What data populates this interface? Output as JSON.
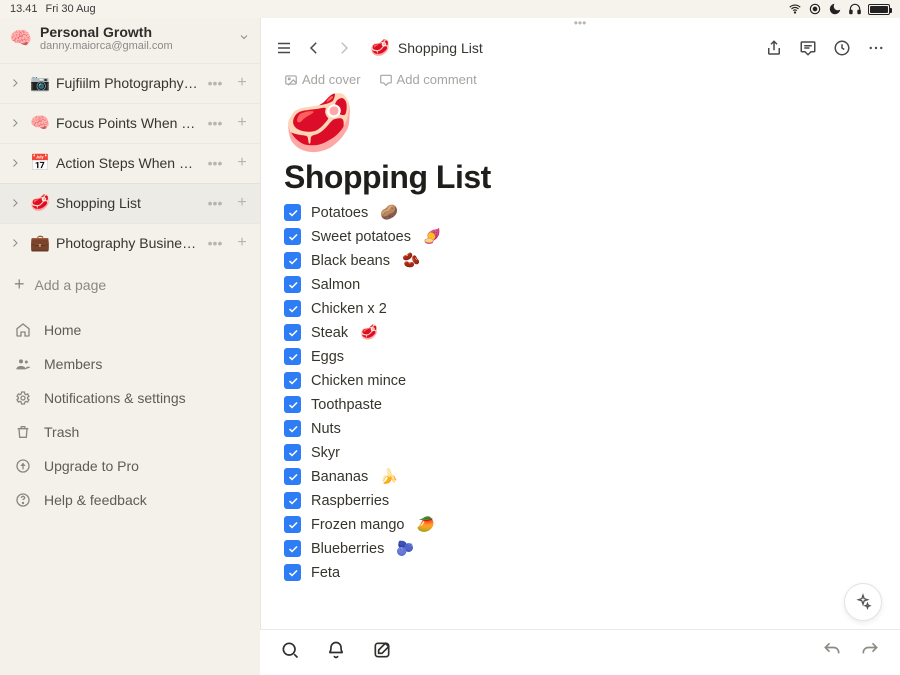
{
  "status": {
    "time": "13.41",
    "date": "Fri 30 Aug"
  },
  "workspace": {
    "name": "Personal Growth",
    "email": "danny.maiorca@gmail.com",
    "icon": "🧠"
  },
  "sidebar": {
    "pages": [
      {
        "icon": "📷",
        "title": "Fujfiilm Photography ..."
      },
      {
        "icon": "🧠",
        "title": "Focus Points When I'..."
      },
      {
        "icon": "📅",
        "title": "Action Steps When B..."
      },
      {
        "icon": "🥩",
        "title": "Shopping List"
      },
      {
        "icon": "💼",
        "title": "Photography Busines..."
      }
    ],
    "active_index": 3,
    "add_page": "Add a page",
    "nav": {
      "home": "Home",
      "members": "Members",
      "settings": "Notifications & settings",
      "trash": "Trash",
      "upgrade": "Upgrade to Pro",
      "help": "Help & feedback"
    }
  },
  "page": {
    "breadcrumb_icon": "🥩",
    "breadcrumb": "Shopping List",
    "add_cover": "Add cover",
    "add_comment": "Add comment",
    "hero_icon": "🥩",
    "title": "Shopping List",
    "items": [
      {
        "text": "Potatoes",
        "emoji": "🥔"
      },
      {
        "text": "Sweet potatoes",
        "emoji": "🍠"
      },
      {
        "text": "Black beans",
        "emoji": "🫘"
      },
      {
        "text": "Salmon",
        "emoji": ""
      },
      {
        "text": "Chicken x 2",
        "emoji": ""
      },
      {
        "text": "Steak",
        "emoji": "🥩"
      },
      {
        "text": "Eggs",
        "emoji": ""
      },
      {
        "text": "Chicken mince",
        "emoji": ""
      },
      {
        "text": "Toothpaste",
        "emoji": ""
      },
      {
        "text": "Nuts",
        "emoji": ""
      },
      {
        "text": "Skyr",
        "emoji": ""
      },
      {
        "text": "Bananas",
        "emoji": "🍌"
      },
      {
        "text": "Raspberries",
        "emoji": ""
      },
      {
        "text": "Frozen mango",
        "emoji": "🥭"
      },
      {
        "text": "Blueberries",
        "emoji": "🫐"
      },
      {
        "text": "Feta",
        "emoji": ""
      }
    ]
  }
}
